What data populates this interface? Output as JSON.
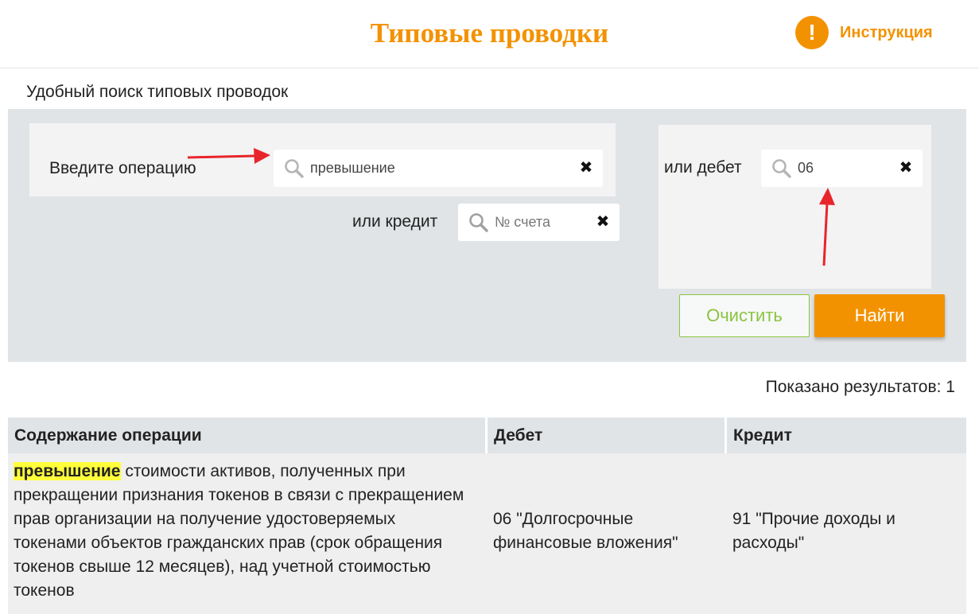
{
  "header": {
    "title": "Типовые проводки",
    "instruction_icon": "!",
    "instruction_label": "Инструкция"
  },
  "subtitle": "Удобный поиск типовых проводок",
  "search": {
    "operation_label": "Введите операцию",
    "operation_value": "превышение",
    "debit_label": "или дебет",
    "debit_value": "06",
    "credit_label": "или кредит",
    "credit_placeholder": "№ счета",
    "clear_glyph": "✖",
    "clear_button": "Очистить",
    "find_button": "Найти"
  },
  "results_count": "Показано результатов: 1",
  "table": {
    "headers": [
      "Содержание операции",
      "Дебет",
      "Кредит"
    ],
    "rows": [
      {
        "highlight": "превышение",
        "operation_rest": " стоимости активов, полученных при прекращении признания токенов в связи с прекращением прав организации на получение удостоверяемых токенами объектов гражданских прав (срок обращения токенов свыше 12 месяцев), над учетной стоимостью токенов",
        "debit": "06 \"Долгосрочные финансовые вложения\"",
        "credit": "91 \"Прочие доходы и расходы\""
      }
    ]
  },
  "colors": {
    "accent": "#f39200",
    "green": "#8ac43f",
    "panel": "#e1e4e6",
    "highlight": "#ffff3b",
    "annotation_arrow": "#e8252b"
  },
  "icons": [
    "exclamation-icon",
    "search-icon",
    "clear-icon",
    "arrow-annotation"
  ]
}
